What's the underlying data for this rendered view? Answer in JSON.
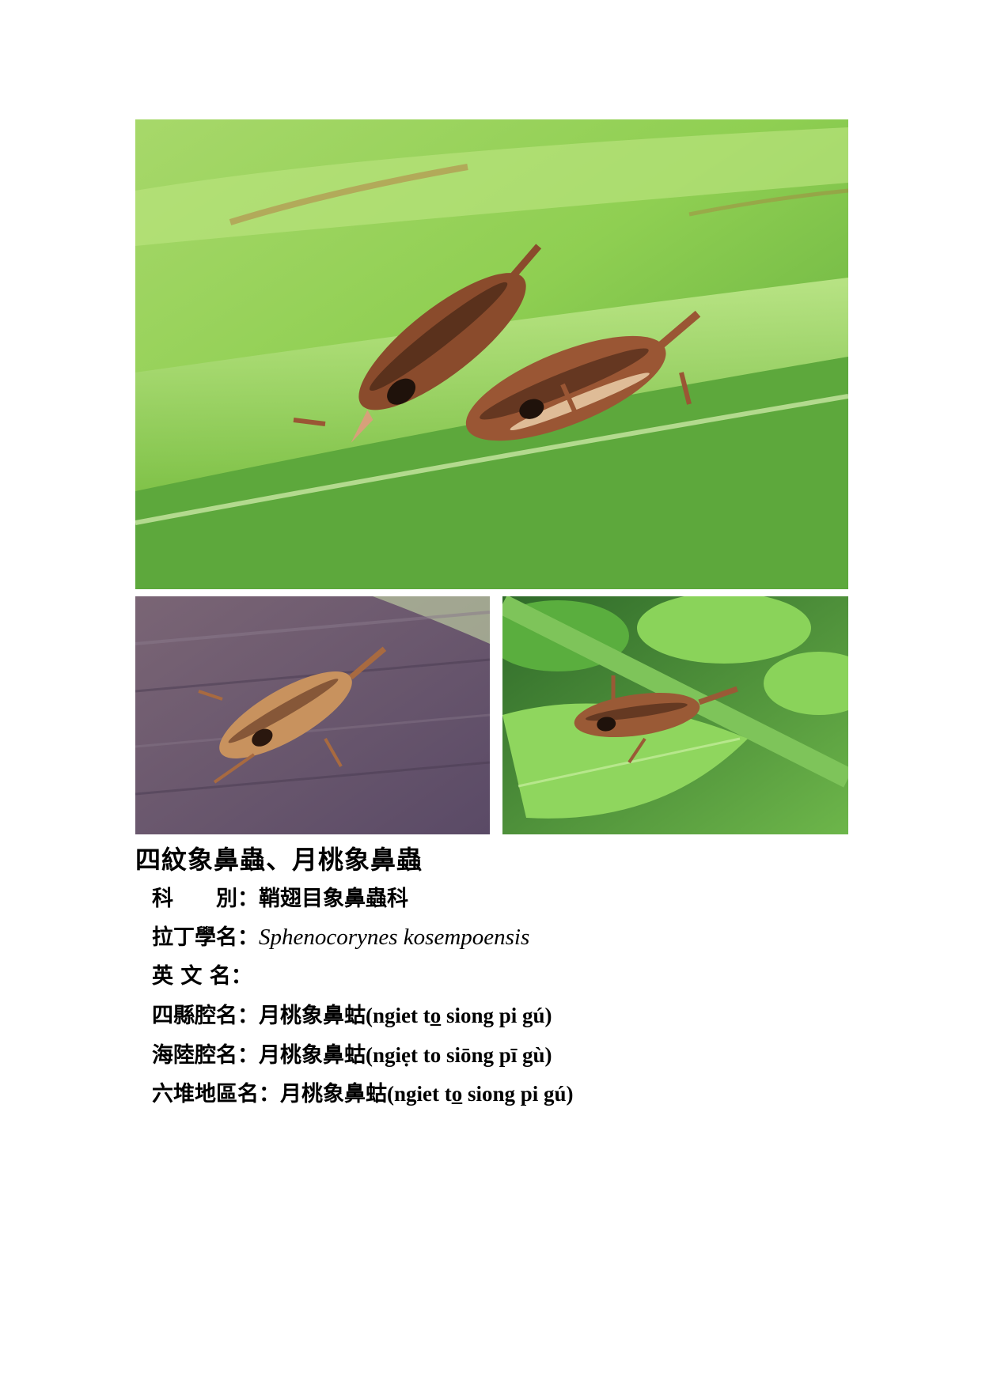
{
  "document": {
    "title": "四紋象鼻蟲、月桃象鼻蟲",
    "fields": [
      {
        "label": "科　　別：",
        "value": "鞘翅目象鼻蟲科"
      },
      {
        "label": "拉丁學名：",
        "value": "Sphenocorynes kosempoensis"
      },
      {
        "label": "英 文 名：",
        "value": ""
      },
      {
        "label": "四縣腔名：",
        "value_cjk": "月桃象鼻蛄",
        "value_rom_a": "(ngiet t",
        "value_rom_u": "o",
        "value_rom_b": " siong pi gú)"
      },
      {
        "label": "海陸腔名：",
        "value_cjk": "月桃象鼻蛄",
        "value_rom": "(ngiẹt to siōng pī gù)"
      },
      {
        "label": "六堆地區名：",
        "value_cjk": "月桃象鼻蛄",
        "value_rom_a": "(ngiet t",
        "value_rom_u": "o",
        "value_rom_b": " siong pi gú)"
      }
    ]
  },
  "colors": {
    "leaf_light": "#9fd65a",
    "leaf_dark": "#4f9a34",
    "beetle_brown": "#8a4b2c",
    "wood_purple": "#6e5a72"
  }
}
